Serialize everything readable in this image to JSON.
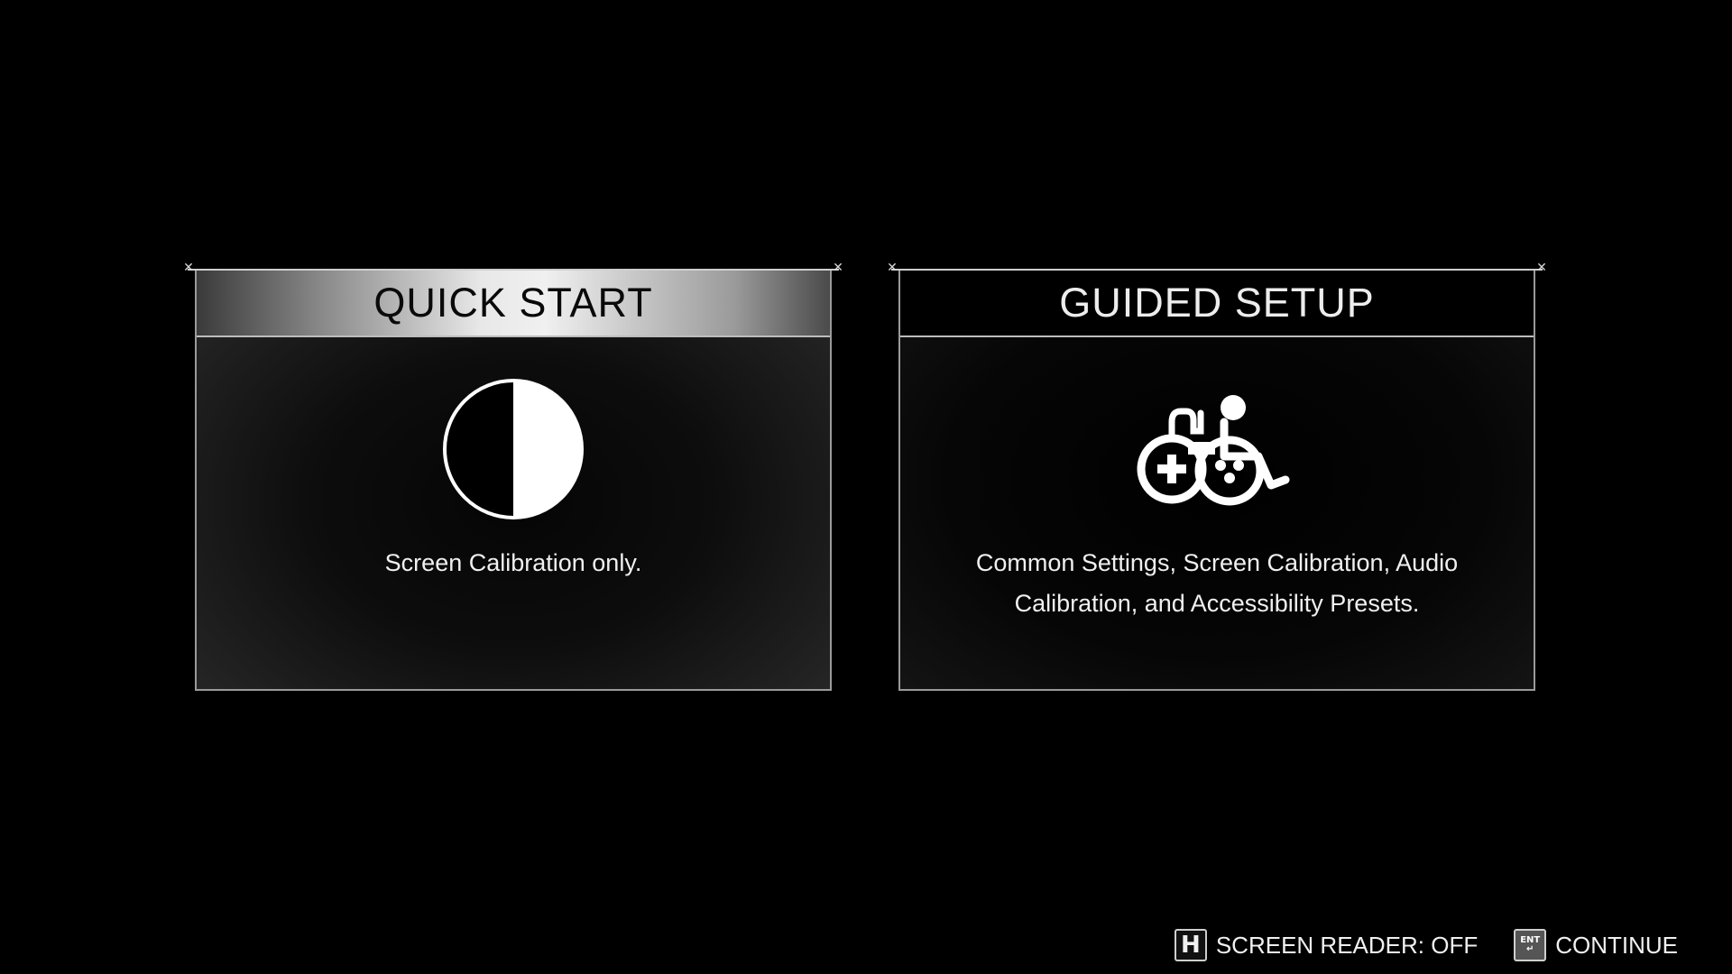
{
  "cards": [
    {
      "title": "QUICK START",
      "description": "Screen Calibration only.",
      "icon": "contrast-half-circle-icon",
      "selected": true
    },
    {
      "title": "GUIDED SETUP",
      "description": "Common Settings, Screen Calibration, Audio Calibration, and Accessibility Presets.",
      "icon": "accessibility-controller-wheelchair-icon",
      "selected": false
    }
  ],
  "footer": {
    "screen_reader": {
      "key": "H",
      "label": "SCREEN READER: OFF"
    },
    "continue": {
      "key": "ENT",
      "label": "CONTINUE"
    }
  },
  "colors": {
    "background": "#000000",
    "text": "#f0f0f0",
    "border": "#9a9a9a"
  }
}
